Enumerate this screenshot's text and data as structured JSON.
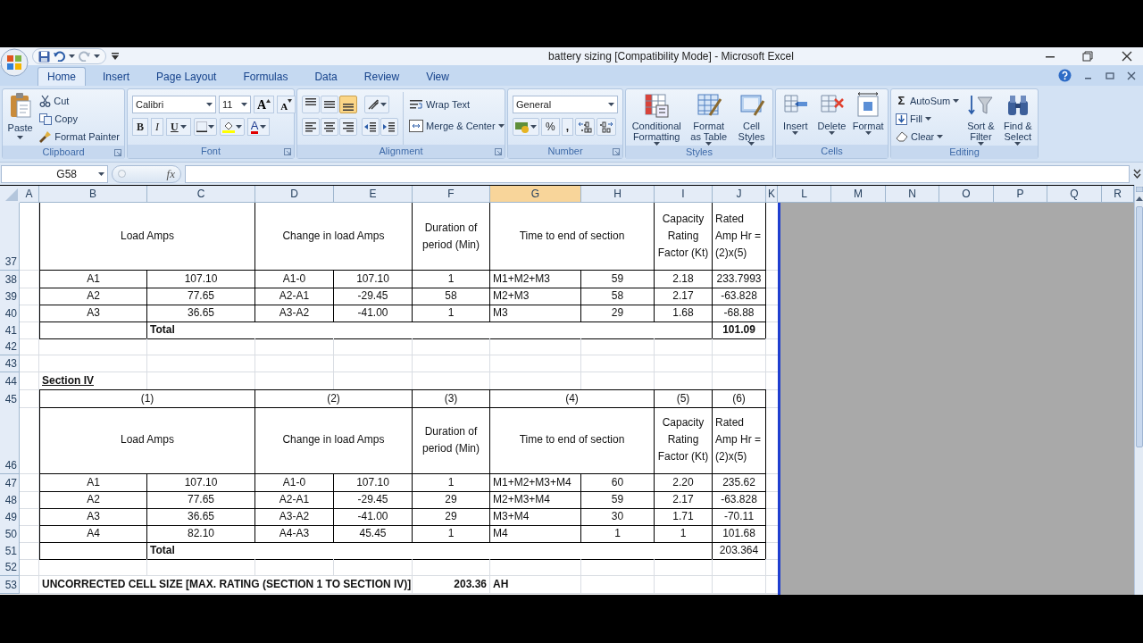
{
  "title_bar": {
    "title": "battery sizing  [Compatibility Mode] - Microsoft Excel"
  },
  "ribbon_tabs": [
    {
      "label": "Home",
      "selected": true
    },
    {
      "label": "Insert",
      "selected": false
    },
    {
      "label": "Page Layout",
      "selected": false
    },
    {
      "label": "Formulas",
      "selected": false
    },
    {
      "label": "Data",
      "selected": false
    },
    {
      "label": "Review",
      "selected": false
    },
    {
      "label": "View",
      "selected": false
    }
  ],
  "ribbon_groups": [
    {
      "kind": "clipboard",
      "label": "Clipboard",
      "paste": "Paste",
      "commands": [
        "Cut",
        "Copy",
        "Format Painter"
      ]
    },
    {
      "kind": "font",
      "label": "Font",
      "font_name": "Calibri",
      "font_size": "11",
      "grow": "A",
      "shrink": "A",
      "bold": "B",
      "italic": "I",
      "underline": "U",
      "font_color": "A"
    },
    {
      "kind": "alignment",
      "label": "Alignment",
      "vertical_align_buttons": [
        {
          "selected": false
        },
        {
          "selected": false
        },
        {
          "selected": true
        }
      ],
      "wrap_text": "Wrap Text",
      "merge": "Merge & Center"
    },
    {
      "kind": "number",
      "label": "Number",
      "format": "General",
      "percent": "%",
      "comma": ","
    },
    {
      "kind": "styles",
      "label": "Styles",
      "commands": [
        "Conditional Formatting",
        "Format as Table",
        "Cell Styles"
      ]
    },
    {
      "kind": "cells",
      "label": "Cells",
      "commands": [
        "Insert",
        "Delete",
        "Format"
      ]
    },
    {
      "kind": "editing",
      "label": "Editing",
      "autosum_symbol": "Σ",
      "small_commands": [
        "AutoSum",
        "Fill",
        "Clear"
      ],
      "commands": [
        "Sort & Filter",
        "Find & Select"
      ]
    }
  ],
  "formula_bar": {
    "name_box": "G58",
    "function_label": "fx"
  },
  "sheet": {
    "columns": [
      {
        "label": "A",
        "selected": false
      },
      {
        "label": "B",
        "selected": false
      },
      {
        "label": "C",
        "selected": false
      },
      {
        "label": "D",
        "selected": false
      },
      {
        "label": "E",
        "selected": false
      },
      {
        "label": "F",
        "selected": false
      },
      {
        "label": "G",
        "selected": true
      },
      {
        "label": "H",
        "selected": false
      },
      {
        "label": "I",
        "selected": false
      },
      {
        "label": "J",
        "selected": false
      },
      {
        "label": "K",
        "selected": false
      },
      {
        "label": "L",
        "selected": false
      },
      {
        "label": "M",
        "selected": false
      },
      {
        "label": "N",
        "selected": false
      },
      {
        "label": "O",
        "selected": false
      },
      {
        "label": "P",
        "selected": false
      },
      {
        "label": "Q",
        "selected": false
      },
      {
        "label": "R",
        "selected": false
      }
    ],
    "rows": [
      {
        "number": "37",
        "kind": "header",
        "cells": [
          "Load Amps",
          "Change in load Amps",
          "Duration of period (Min)",
          "Time to end of section",
          "Capacity Rating Factor (Kt)",
          "Rated Amp Hr = (2)x(5)"
        ]
      },
      {
        "number": "38",
        "kind": "data",
        "cells": [
          "A1",
          "107.10",
          "A1-0",
          "107.10",
          "1",
          "M1+M2+M3",
          "59",
          "2.18",
          "233.7993"
        ]
      },
      {
        "number": "39",
        "kind": "data",
        "cells": [
          "A2",
          "77.65",
          "A2-A1",
          "-29.45",
          "58",
          "M2+M3",
          "58",
          "2.17",
          "-63.828"
        ]
      },
      {
        "number": "40",
        "kind": "data",
        "cells": [
          "A3",
          "36.65",
          "A3-A2",
          "-41.00",
          "1",
          "M3",
          "29",
          "1.68",
          "-68.88"
        ]
      },
      {
        "number": "41",
        "kind": "total",
        "value_bold": true,
        "cells": [
          "Total",
          "101.09"
        ]
      },
      {
        "number": "42",
        "kind": "blank"
      },
      {
        "number": "43",
        "kind": "blank"
      },
      {
        "number": "44",
        "kind": "title",
        "cells": [
          "Section IV"
        ]
      },
      {
        "number": "45",
        "kind": "numbering",
        "cells": [
          "(1)",
          "(2)",
          "(3)",
          "(4)",
          "(5)",
          "(6)"
        ]
      },
      {
        "number": "46",
        "kind": "header",
        "cells": [
          "Load Amps",
          "Change in load Amps",
          "Duration of period (Min)",
          "Time to end of section",
          "Capacity Rating Factor (Kt)",
          "Rated Amp Hr = (2)x(5)"
        ]
      },
      {
        "number": "47",
        "kind": "data",
        "cells": [
          "A1",
          "107.10",
          "A1-0",
          "107.10",
          "1",
          "M1+M2+M3+M4",
          "60",
          "2.20",
          "235.62"
        ]
      },
      {
        "number": "48",
        "kind": "data",
        "cells": [
          "A2",
          "77.65",
          "A2-A1",
          "-29.45",
          "29",
          "M2+M3+M4",
          "59",
          "2.17",
          "-63.828"
        ]
      },
      {
        "number": "49",
        "kind": "data",
        "cells": [
          "A3",
          "36.65",
          "A3-A2",
          "-41.00",
          "29",
          "M3+M4",
          "30",
          "1.71",
          "-70.11"
        ]
      },
      {
        "number": "50",
        "kind": "data",
        "cells": [
          "A4",
          "82.10",
          "A4-A3",
          "45.45",
          "1",
          "M4",
          "1",
          "1",
          "101.68"
        ]
      },
      {
        "number": "51",
        "kind": "total",
        "value_bold": false,
        "cells": [
          "Total",
          "203.364"
        ]
      },
      {
        "number": "52",
        "kind": "blank"
      },
      {
        "number": "53",
        "kind": "summary",
        "cells": [
          "UNCORRECTED CELL SIZE [MAX. RATING (SECTION 1 TO SECTION IV)]",
          "203.36",
          "AH"
        ]
      }
    ]
  }
}
